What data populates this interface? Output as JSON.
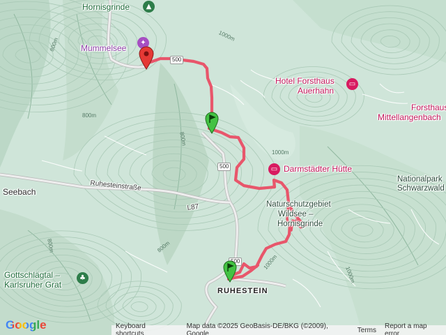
{
  "places": {
    "hornisgrinde": "Hornisgrinde",
    "mummelsee": "Mummelsee",
    "hotel_line1": "Hotel Forsthaus",
    "hotel_line2": "Auerhahn",
    "forsthaus_line1": "Forsthaus",
    "forsthaus_line2": "Mittellangenbach",
    "darmstaedter": "Darmstädter Hütte",
    "seebach": "Seebach",
    "nationalpark_line1": "Nationalpark",
    "nationalpark_line2": "Schwarzwald",
    "naturschutz_line1": "Naturschutzgebiet",
    "naturschutz_line2": "Wildsee –",
    "naturschutz_line3": "Hornisgrinde",
    "gottschlaeg_line1": "Gottschlägtal –",
    "gottschlaeg_line2": "Karlsruher Grat",
    "ruhestein": "RUHESTEIN",
    "ruhesteinstrasse": "Ruhesteinstraße",
    "l87": "L87"
  },
  "road_shields": {
    "s500_top": "500",
    "s500_mid": "500",
    "s500_low": "500"
  },
  "elevations": {
    "e1": "1000m",
    "e2": "800m",
    "e3": "1000m",
    "e4": "800m",
    "e5": "800m",
    "e6": "1000m",
    "e7": "800m",
    "e8": "1000m",
    "e9": "800m"
  },
  "footer": {
    "google_logo": "Google",
    "keyboard_shortcuts": "Keyboard shortcuts",
    "map_data": "Map data ©2025 GeoBasis-DE/BKG (©2009), Google",
    "terms": "Terms",
    "report": "Report a map error"
  },
  "icons": {
    "mountain": "mountain-icon",
    "attraction": "attraction-icon",
    "hotel": "hotel-icon",
    "park": "park-icon",
    "start_marker": "red-pin-icon",
    "flag_marker": "green-flag-icon"
  },
  "colors": {
    "route": "#e8566b",
    "terrain": "#cfe5d9",
    "hotel_pink": "#d81b60",
    "poi_purple": "#a64fc2",
    "park_green": "#2e7d4a"
  }
}
